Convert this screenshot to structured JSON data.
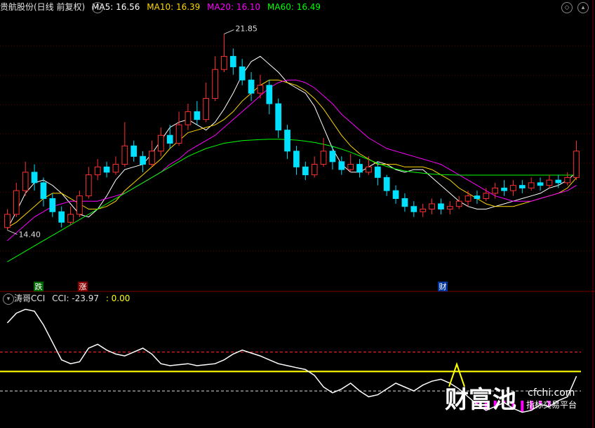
{
  "header": {
    "stock": "贵航股份(日线 前复权)",
    "ma5": "MA5: 16.56",
    "ma10": "MA10: 16.39",
    "ma20": "MA20: 16.10",
    "ma60": "MA60: 16.49",
    "colors": {
      "ma5": "#ffffff",
      "ma10": "#ffd700",
      "ma20": "#ff00ff",
      "ma60": "#00ff00"
    }
  },
  "subheader": {
    "indicator": "涛哥CCI",
    "cci": "CCI: -23.97",
    "second": ": 0.00"
  },
  "markers": {
    "die": "跌",
    "zhang": "涨",
    "cai": "财"
  },
  "watermark": {
    "brand": "财富池",
    "url": "cfchi.com",
    "slogan": "指标交易平台"
  },
  "chart_data": [
    {
      "type": "candlestick",
      "annotations": {
        "high": "21.85",
        "low": "14.40"
      },
      "series": [
        {
          "name": "MA5",
          "values": [
            14.45,
            15.1,
            15.8,
            16.2,
            16.3,
            16.1,
            15.8,
            15.4,
            15.0,
            14.9,
            15.2,
            15.7,
            16.3,
            16.7,
            16.8,
            16.9,
            17.3,
            17.8,
            18.3,
            18.5,
            18.6,
            18.4,
            18.2,
            18.5,
            19.0,
            19.6,
            20.3,
            20.8,
            21.0,
            20.7,
            20.4,
            20.0,
            19.8,
            19.6,
            19.1,
            18.3,
            17.5,
            16.9,
            16.6,
            16.6,
            16.8,
            17.0,
            16.9,
            16.7,
            16.6,
            16.7,
            16.7,
            16.4,
            16.1,
            15.8,
            15.5,
            15.3,
            15.2,
            15.2,
            15.3,
            15.4,
            15.5,
            15.6,
            15.7,
            15.8,
            16.0,
            16.1,
            16.3,
            16.6
          ]
        },
        {
          "name": "MA10",
          "values": [
            14.5,
            14.7,
            15.0,
            15.3,
            15.6,
            15.8,
            15.8,
            15.6,
            15.4,
            15.2,
            15.2,
            15.3,
            15.5,
            15.9,
            16.2,
            16.5,
            16.8,
            17.1,
            17.5,
            17.8,
            18.1,
            18.2,
            18.3,
            18.4,
            18.6,
            18.9,
            19.3,
            19.6,
            19.9,
            20.1,
            20.1,
            20.0,
            19.9,
            19.7,
            19.4,
            19.0,
            18.5,
            18.0,
            17.6,
            17.3,
            17.1,
            16.9,
            16.9,
            16.9,
            16.8,
            16.8,
            16.8,
            16.7,
            16.5,
            16.3,
            16.0,
            15.8,
            15.6,
            15.4,
            15.3,
            15.3,
            15.3,
            15.4,
            15.5,
            15.6,
            15.7,
            15.8,
            16.0,
            16.39
          ]
        },
        {
          "name": "MA20",
          "values": [
            14.0,
            14.3,
            14.6,
            14.9,
            15.1,
            15.3,
            15.4,
            15.5,
            15.5,
            15.5,
            15.5,
            15.6,
            15.7,
            15.8,
            16.0,
            16.2,
            16.4,
            16.6,
            16.9,
            17.1,
            17.4,
            17.6,
            17.8,
            18.0,
            18.3,
            18.6,
            18.9,
            19.2,
            19.5,
            19.8,
            20.0,
            20.1,
            20.1,
            20.0,
            19.8,
            19.5,
            19.2,
            18.8,
            18.5,
            18.2,
            17.9,
            17.7,
            17.5,
            17.4,
            17.3,
            17.2,
            17.1,
            17.0,
            16.9,
            16.7,
            16.5,
            16.3,
            16.1,
            15.9,
            15.7,
            15.6,
            15.5,
            15.5,
            15.5,
            15.6,
            15.7,
            15.8,
            15.9,
            16.1
          ]
        },
        {
          "name": "MA60",
          "values": [
            13.2,
            13.4,
            13.6,
            13.8,
            14.0,
            14.2,
            14.4,
            14.6,
            14.8,
            15.0,
            15.2,
            15.4,
            15.6,
            15.8,
            16.0,
            16.2,
            16.4,
            16.6,
            16.8,
            17.0,
            17.2,
            17.35,
            17.5,
            17.6,
            17.7,
            17.75,
            17.8,
            17.82,
            17.84,
            17.85,
            17.85,
            17.84,
            17.82,
            17.78,
            17.73,
            17.66,
            17.58,
            17.48,
            17.36,
            17.22,
            17.08,
            16.94,
            16.82,
            16.72,
            16.65,
            16.6,
            16.56,
            16.53,
            16.51,
            16.5,
            16.49,
            16.49,
            16.49,
            16.49,
            16.49,
            16.49,
            16.49,
            16.49,
            16.49,
            16.49,
            16.49,
            16.49,
            16.49,
            16.49
          ]
        }
      ],
      "candles": [
        [
          14.5,
          15.0,
          15.2,
          14.4
        ],
        [
          15.0,
          15.9,
          16.2,
          14.9
        ],
        [
          15.9,
          16.6,
          17.0,
          15.7
        ],
        [
          16.6,
          16.2,
          16.9,
          15.9
        ],
        [
          16.2,
          15.6,
          16.4,
          15.3
        ],
        [
          15.6,
          15.1,
          15.8,
          14.9
        ],
        [
          15.1,
          14.7,
          15.3,
          14.5
        ],
        [
          14.7,
          15.0,
          15.3,
          14.6
        ],
        [
          15.0,
          15.7,
          15.9,
          14.9
        ],
        [
          15.7,
          16.5,
          16.8,
          15.6
        ],
        [
          16.5,
          16.8,
          17.1,
          16.3
        ],
        [
          16.8,
          16.6,
          17.0,
          16.4
        ],
        [
          16.6,
          16.9,
          17.2,
          16.5
        ],
        [
          16.9,
          17.6,
          18.5,
          16.8
        ],
        [
          17.6,
          17.2,
          17.8,
          17.0
        ],
        [
          17.2,
          16.9,
          17.4,
          16.6
        ],
        [
          16.9,
          17.4,
          17.8,
          16.8
        ],
        [
          17.4,
          18.0,
          18.3,
          17.2
        ],
        [
          18.0,
          17.7,
          18.4,
          17.5
        ],
        [
          17.7,
          18.4,
          18.9,
          17.6
        ],
        [
          18.4,
          18.9,
          19.2,
          18.2
        ],
        [
          18.9,
          18.6,
          19.3,
          18.4
        ],
        [
          18.6,
          19.4,
          20.0,
          18.5
        ],
        [
          19.4,
          20.5,
          21.0,
          19.3
        ],
        [
          20.5,
          21.0,
          21.85,
          20.4
        ],
        [
          21.0,
          20.6,
          21.3,
          20.3
        ],
        [
          20.6,
          20.1,
          20.9,
          19.9
        ],
        [
          20.1,
          19.6,
          20.4,
          19.3
        ],
        [
          19.6,
          19.9,
          20.3,
          19.4
        ],
        [
          19.9,
          19.2,
          20.1,
          18.8
        ],
        [
          19.2,
          18.2,
          19.4,
          17.9
        ],
        [
          18.2,
          17.4,
          18.4,
          17.1
        ],
        [
          17.4,
          16.8,
          17.6,
          16.5
        ],
        [
          16.8,
          16.5,
          17.0,
          16.3
        ],
        [
          16.5,
          16.9,
          17.2,
          16.4
        ],
        [
          16.9,
          17.4,
          17.9,
          16.8
        ],
        [
          17.4,
          17.0,
          17.6,
          16.7
        ],
        [
          17.0,
          16.7,
          17.2,
          16.5
        ],
        [
          16.7,
          16.9,
          17.3,
          16.6
        ],
        [
          16.9,
          16.6,
          17.1,
          16.4
        ],
        [
          16.6,
          16.8,
          17.2,
          16.5
        ],
        [
          16.8,
          16.4,
          17.0,
          16.1
        ],
        [
          16.4,
          15.9,
          16.5,
          15.7
        ],
        [
          15.9,
          15.6,
          16.1,
          15.4
        ],
        [
          15.6,
          15.3,
          15.8,
          15.1
        ],
        [
          15.3,
          15.1,
          15.5,
          14.9
        ],
        [
          15.1,
          15.2,
          15.4,
          14.9
        ],
        [
          15.2,
          15.4,
          15.6,
          15.0
        ],
        [
          15.4,
          15.2,
          15.6,
          15.0
        ],
        [
          15.2,
          15.3,
          15.5,
          15.0
        ],
        [
          15.3,
          15.5,
          15.7,
          15.2
        ],
        [
          15.5,
          15.7,
          15.9,
          15.3
        ],
        [
          15.7,
          15.6,
          15.9,
          15.4
        ],
        [
          15.6,
          15.8,
          16.0,
          15.5
        ],
        [
          15.8,
          16.0,
          16.2,
          15.6
        ],
        [
          16.0,
          15.9,
          16.3,
          15.7
        ],
        [
          15.9,
          16.1,
          16.3,
          15.7
        ],
        [
          16.1,
          16.0,
          16.3,
          15.8
        ],
        [
          16.0,
          16.2,
          16.4,
          15.9
        ],
        [
          16.2,
          16.1,
          16.4,
          15.9
        ],
        [
          16.1,
          16.3,
          16.5,
          16.0
        ],
        [
          16.3,
          16.2,
          16.5,
          16.0
        ],
        [
          16.2,
          16.4,
          16.6,
          16.1
        ],
        [
          16.4,
          17.4,
          17.8,
          16.3
        ]
      ]
    },
    {
      "type": "line",
      "series": [
        {
          "name": "CCI",
          "values": [
            250,
            300,
            320,
            310,
            240,
            150,
            60,
            40,
            50,
            120,
            140,
            110,
            90,
            80,
            100,
            120,
            90,
            40,
            30,
            35,
            40,
            30,
            35,
            40,
            60,
            90,
            110,
            95,
            80,
            60,
            40,
            30,
            20,
            10,
            -20,
            -80,
            -110,
            -90,
            -60,
            -100,
            -130,
            -120,
            -90,
            -60,
            -80,
            -100,
            -70,
            -50,
            -40,
            -60,
            -90,
            -130,
            -170,
            -200,
            -180,
            -160,
            -190,
            -210,
            -200,
            -170,
            -180,
            -150,
            -130,
            -23.97
          ]
        }
      ],
      "levels": {
        "upper": 100,
        "lower": -100,
        "zero": 0
      }
    }
  ]
}
